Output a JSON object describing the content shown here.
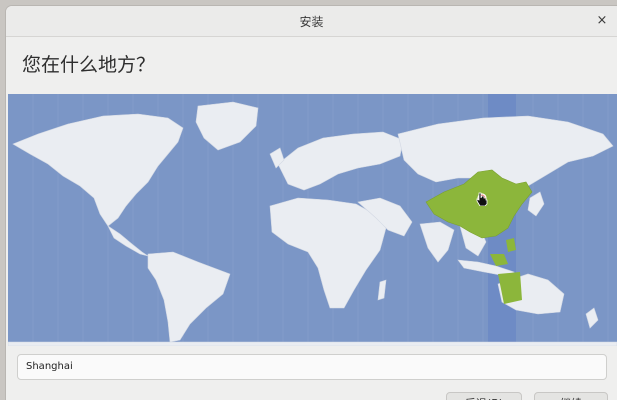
{
  "window": {
    "title": "安装",
    "close_glyph": "×"
  },
  "page": {
    "heading": "您在什么地方？"
  },
  "map": {
    "selected_region": "China",
    "highlight_color": "#8bb63a",
    "ocean_color": "#7a97c8",
    "land_color": "#e9ecf1"
  },
  "timezone": {
    "value": "Shanghai"
  },
  "buttons": {
    "back_label": "后退(B)",
    "next_label": "继续"
  }
}
